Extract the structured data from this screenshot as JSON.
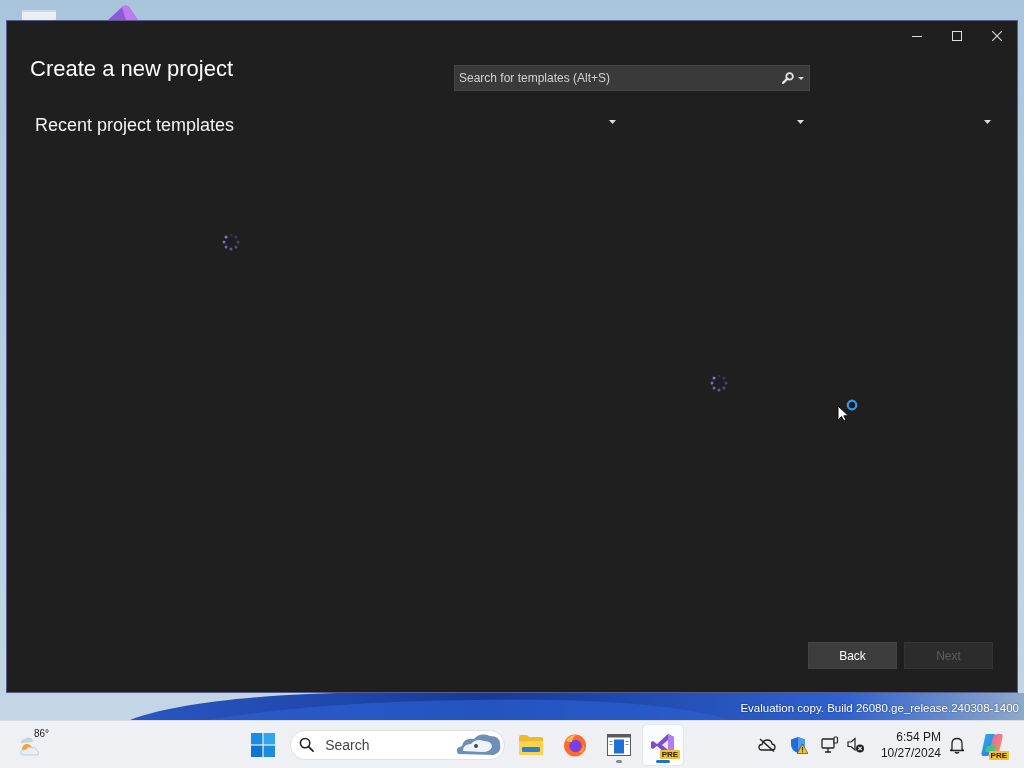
{
  "desktop": {
    "watermark": "Evaluation copy. Build 26080.ge_release.240308-1400"
  },
  "window": {
    "title": "Create a new project",
    "search": {
      "placeholder": "Search for templates (Alt+S)"
    },
    "recent": {
      "heading": "Recent project templates",
      "loading": true
    },
    "filters": [
      {
        "expanded": false
      },
      {
        "expanded": false
      },
      {
        "expanded": false
      }
    ],
    "templates": {
      "loading": true
    },
    "buttons": [
      {
        "label": "Back",
        "disabled": false
      },
      {
        "label": "Next",
        "disabled": true
      }
    ]
  },
  "cursor": {
    "busy": true
  },
  "taskbar": {
    "weather": {
      "temperature": "86°"
    },
    "search": {
      "placeholder": "Search"
    },
    "apps": [
      {
        "kind": "file-explorer",
        "running": false,
        "selected": false
      },
      {
        "kind": "browser",
        "running": false,
        "selected": false
      },
      {
        "kind": "app-window",
        "running": true,
        "selected": false
      },
      {
        "kind": "ide",
        "running": true,
        "selected": true,
        "badge": "PRE"
      }
    ],
    "clock": {
      "time": "6:54 PM",
      "date": "10/27/2024"
    },
    "copilot": {
      "badge": "PRE"
    }
  }
}
